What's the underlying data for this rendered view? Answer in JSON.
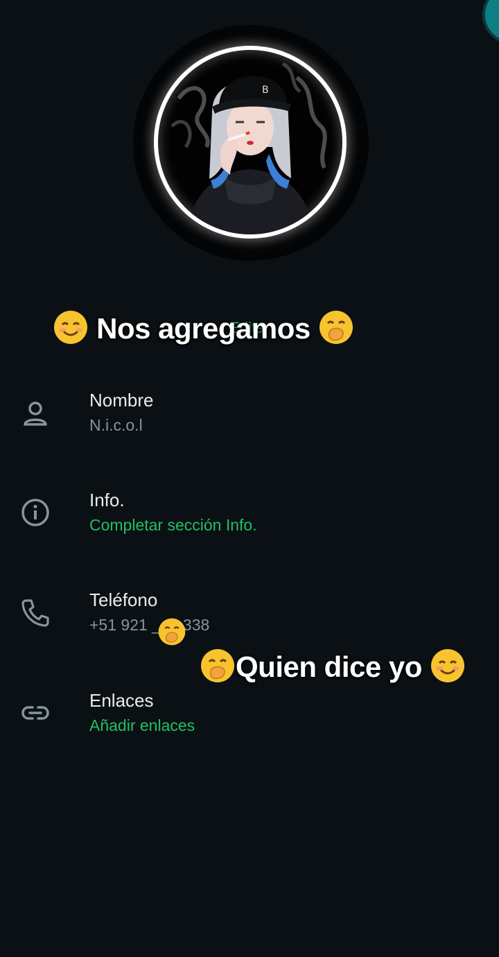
{
  "profile": {
    "edit_label": "Editar"
  },
  "captions": {
    "top": "Nos agregamos",
    "middle": "Quien dice  yo"
  },
  "fields": {
    "name": {
      "title": "Nombre",
      "value": "N.i.c.o.l",
      "icon": "person-icon"
    },
    "info": {
      "title": "Info.",
      "value": "Completar sección Info.",
      "icon": "info-icon"
    },
    "phone": {
      "title": "Teléfono",
      "value": "+51 921 ___ 338",
      "icon": "phone-icon"
    },
    "links": {
      "title": "Enlaces",
      "value": "Añadir enlaces",
      "icon": "link-icon"
    }
  },
  "colors": {
    "background": "#0b1014",
    "accent_green": "#21c063",
    "primary_text": "#e9edef",
    "secondary_text": "#8696a0"
  }
}
